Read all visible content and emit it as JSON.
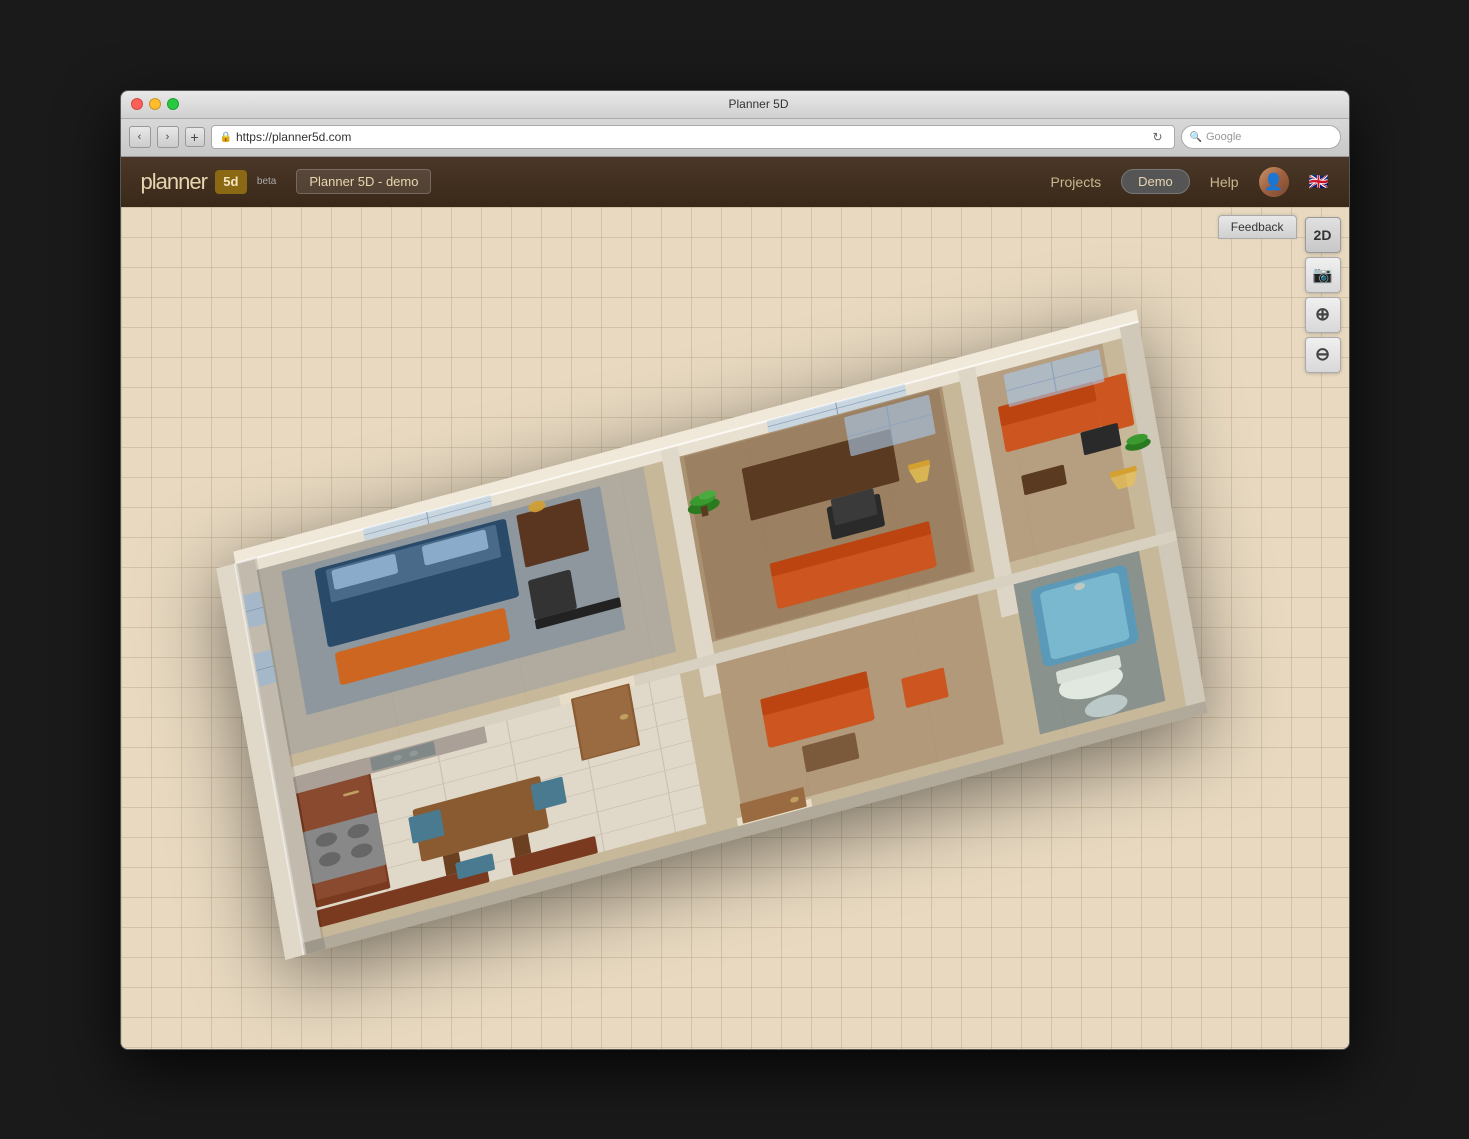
{
  "window": {
    "title": "Planner 5D",
    "controls": {
      "close": "close",
      "minimize": "minimize",
      "maximize": "maximize"
    }
  },
  "browser": {
    "back_label": "‹",
    "forward_label": "›",
    "add_tab_label": "+",
    "url": "https://planner5d.com",
    "refresh_label": "↻",
    "search_placeholder": "Google"
  },
  "header": {
    "logo_text": "planner",
    "logo_suffix": "5d",
    "beta_label": "beta",
    "project_name": "Planner 5D - demo",
    "nav": {
      "projects_label": "Projects",
      "demo_label": "Demo",
      "help_label": "Help"
    }
  },
  "toolbar": {
    "view_2d_label": "2D",
    "screenshot_label": "📷",
    "zoom_in_label": "⊕",
    "zoom_out_label": "⊖",
    "feedback_label": "Feedback"
  },
  "floorplan": {
    "rooms": [
      {
        "name": "bedroom-1",
        "color": "#6B9FD4"
      },
      {
        "name": "living-room",
        "color": "#8B6F4E"
      },
      {
        "name": "kitchen",
        "color": "#C8B89A"
      },
      {
        "name": "bathroom",
        "color": "#4A90B8"
      },
      {
        "name": "office",
        "color": "#8B6F4E"
      }
    ]
  }
}
